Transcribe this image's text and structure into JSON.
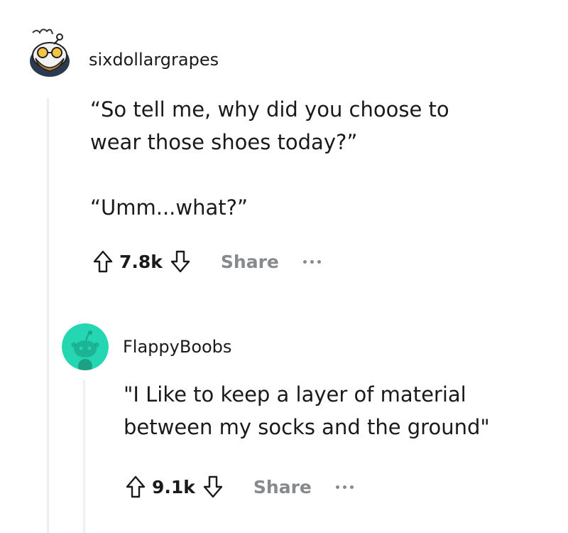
{
  "comments": [
    {
      "username": "sixdollargrapes",
      "paragraphs": [
        "“So tell me, why did you choose to wear those shoes today?”",
        "“Umm...what?”"
      ],
      "score": "7.8k",
      "share_label": "Share",
      "avatar_icon": "snoo-chef-avatar-icon"
    },
    {
      "username": "FlappyBoobs",
      "paragraphs": [
        "\"I Like to keep a layer of material between my socks and the ground\""
      ],
      "score": "9.1k",
      "share_label": "Share",
      "avatar_icon": "snoo-teal-avatar-icon"
    }
  ],
  "colors": {
    "thread_line": "#edeff1",
    "share_text": "#878a8c",
    "avatar_teal": "#24d6b2",
    "text": "#1a1a1b"
  }
}
